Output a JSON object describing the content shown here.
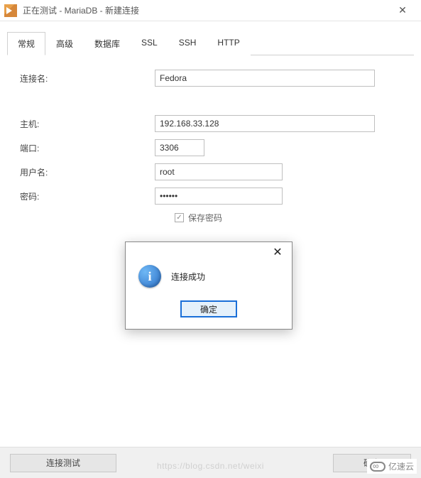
{
  "window": {
    "title": "正在测试 - MariaDB - 新建连接"
  },
  "tabs": {
    "general": "常规",
    "advanced": "高级",
    "database": "数据库",
    "ssl": "SSL",
    "ssh": "SSH",
    "http": "HTTP",
    "active": "general"
  },
  "form": {
    "conn_name_label": "连接名:",
    "conn_name_value": "Fedora",
    "host_label": "主机:",
    "host_value": "192.168.33.128",
    "port_label": "端口:",
    "port_value": "3306",
    "user_label": "用户名:",
    "user_value": "root",
    "password_label": "密码:",
    "password_value": "••••••",
    "save_password_label": "保存密码",
    "save_password_checked": true
  },
  "buttons": {
    "test": "连接测试",
    "ok": "确定"
  },
  "modal": {
    "message": "连接成功",
    "ok": "确定"
  },
  "watermark": {
    "url": "https://blog.csdn.net/weixi",
    "brand": "亿速云"
  }
}
